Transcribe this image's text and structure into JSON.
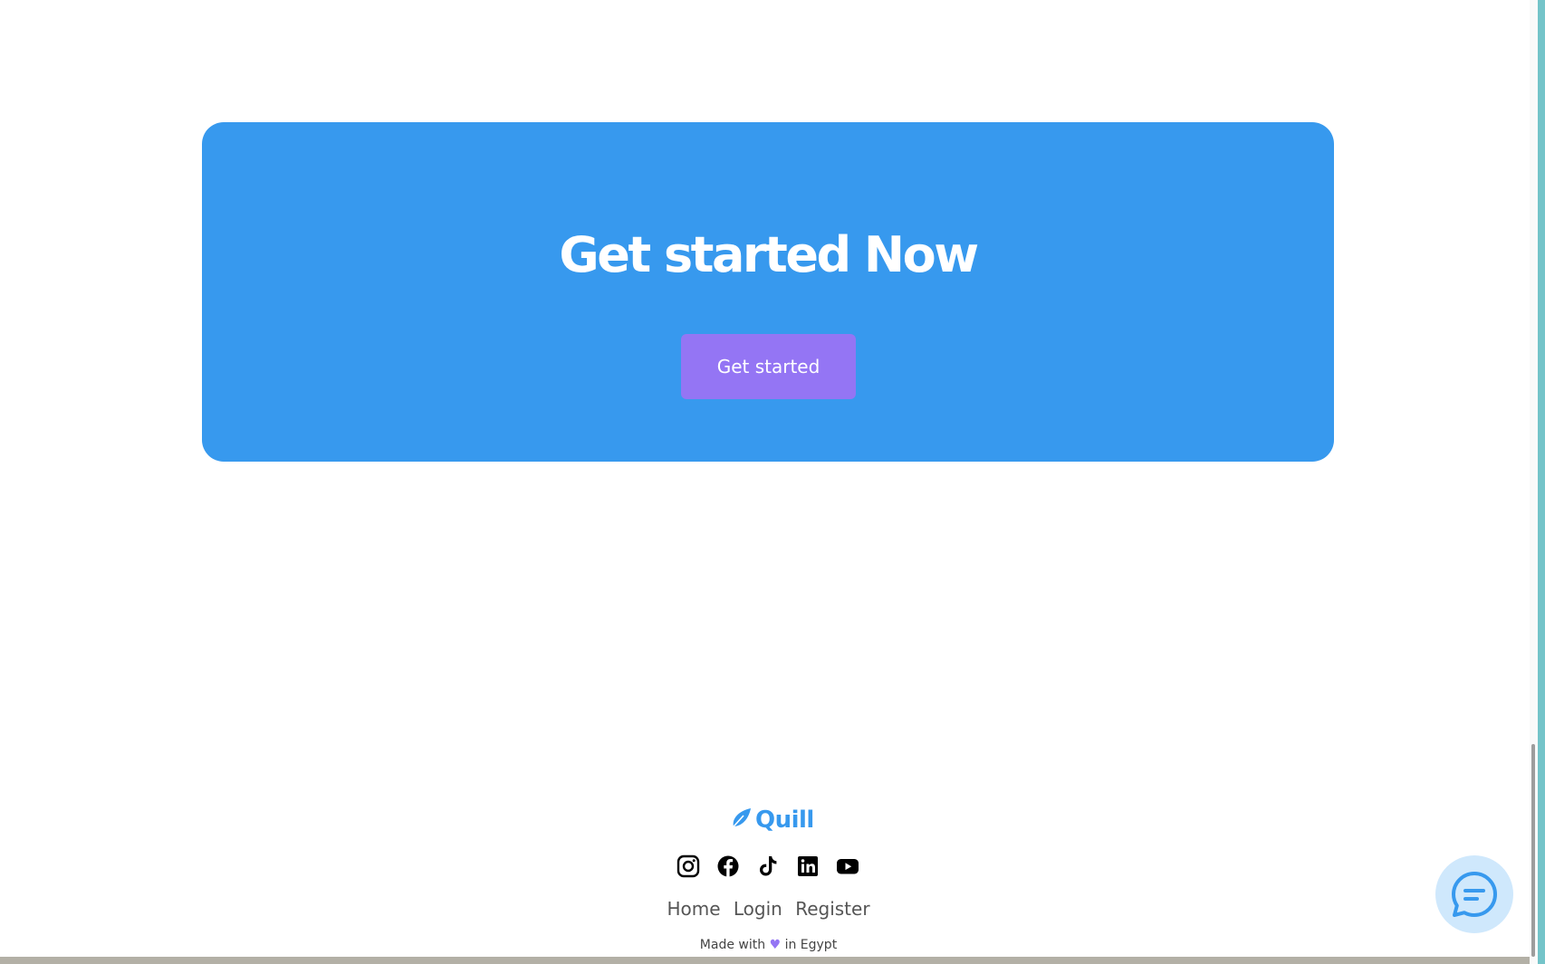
{
  "cta": {
    "title": "Get started Now",
    "button_label": "Get started"
  },
  "footer": {
    "logo_text": "Quill",
    "social_icons": [
      "instagram-icon",
      "facebook-icon",
      "tiktok-icon",
      "linkedin-icon",
      "youtube-icon"
    ],
    "nav": {
      "home": "Home",
      "login": "Login",
      "register": "Register"
    },
    "made_with": {
      "prefix": "Made with",
      "heart": "♥",
      "suffix": "in Egypt"
    }
  },
  "colors": {
    "brand_blue": "#3799ee",
    "accent_purple": "#9475f4",
    "chat_bubble_bg": "#cfe8fc"
  }
}
